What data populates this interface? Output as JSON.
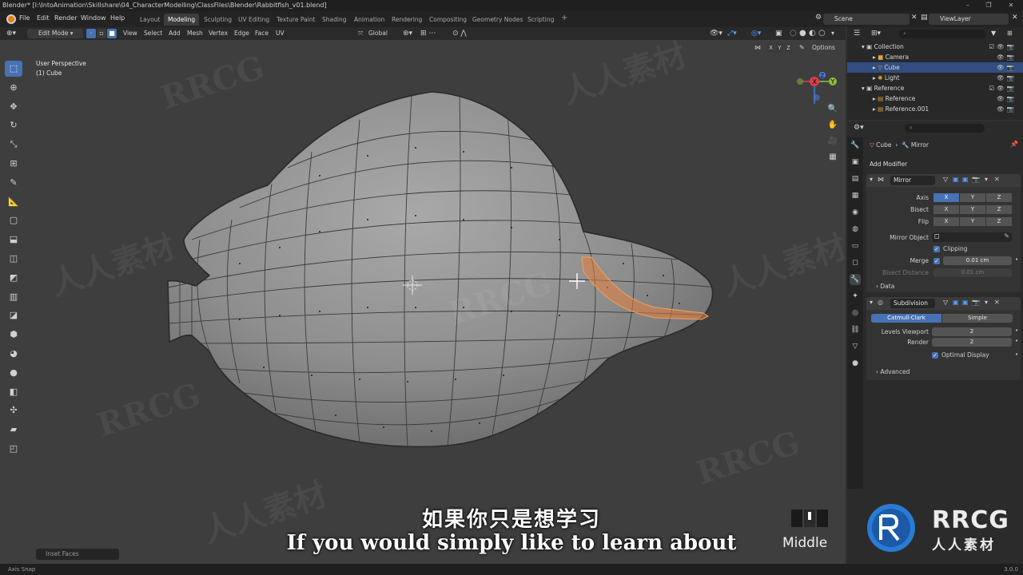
{
  "window": {
    "title": "Blender* [I:\\IntoAnimation\\Skillshare\\04_CharacterModelling\\ClassFiles\\Blender\\Rabbitfish_v01.blend]"
  },
  "menu": [
    "File",
    "Edit",
    "Render",
    "Window",
    "Help"
  ],
  "workspaces": [
    {
      "label": "Layout",
      "active": false
    },
    {
      "label": "Modeling",
      "active": true
    },
    {
      "label": "Sculpting",
      "active": false
    },
    {
      "label": "UV Editing",
      "active": false
    },
    {
      "label": "Texture Paint",
      "active": false
    },
    {
      "label": "Shading",
      "active": false
    },
    {
      "label": "Animation",
      "active": false
    },
    {
      "label": "Rendering",
      "active": false
    },
    {
      "label": "Compositing",
      "active": false
    },
    {
      "label": "Geometry Nodes",
      "active": false
    },
    {
      "label": "Scripting",
      "active": false
    }
  ],
  "scene": {
    "name": "Scene",
    "view_layer": "ViewLayer"
  },
  "viewport": {
    "mode": "Edit Mode",
    "menus": [
      "View",
      "Select",
      "Add",
      "Mesh",
      "Vertex",
      "Edge",
      "Face",
      "UV"
    ],
    "orientation": "Global",
    "perspective_label": "User Perspective",
    "object_label": "(1) Cube",
    "axes": [
      "X",
      "Y",
      "Z"
    ],
    "options_label": "Options",
    "gizmo_labels": {
      "x": "X",
      "y": "Y",
      "z": "Z"
    }
  },
  "outliner": {
    "rows": [
      {
        "label": "Collection",
        "indent": 1,
        "selected": false,
        "icon": "collection-icon"
      },
      {
        "label": "Camera",
        "indent": 2,
        "selected": false,
        "icon": "camera-icon"
      },
      {
        "label": "Cube",
        "indent": 2,
        "selected": true,
        "icon": "mesh-icon"
      },
      {
        "label": "Light",
        "indent": 2,
        "selected": false,
        "icon": "light-icon"
      },
      {
        "label": "Reference",
        "indent": 1,
        "selected": false,
        "icon": "collection-icon"
      },
      {
        "label": "Reference",
        "indent": 2,
        "selected": false,
        "icon": "image-icon"
      },
      {
        "label": "Reference.001",
        "indent": 2,
        "selected": false,
        "icon": "image-icon"
      }
    ]
  },
  "properties": {
    "breadcrumb_object": "Cube",
    "breadcrumb_modifier": "Mirror",
    "add_modifier_label": "Add Modifier",
    "mirror": {
      "name": "Mirror",
      "axis_label": "Axis",
      "bisect_label": "Bisect",
      "flip_label": "Flip",
      "axis": [
        true,
        false,
        false
      ],
      "bisect": [
        false,
        false,
        false
      ],
      "flip": [
        false,
        false,
        false
      ],
      "xyz": [
        "X",
        "Y",
        "Z"
      ],
      "mirror_object_label": "Mirror Object",
      "clipping_label": "Clipping",
      "merge_label": "Merge",
      "merge_value": "0.01 cm",
      "bisect_distance_label": "Bisect Distance",
      "bisect_distance_value": "0.01 cm",
      "data_label": "Data"
    },
    "subdivision": {
      "name": "Subdivision",
      "mode_catmull": "Catmull-Clark",
      "mode_simple": "Simple",
      "levels_viewport_label": "Levels Viewport",
      "levels_viewport_value": "2",
      "render_label": "Render",
      "render_value": "2",
      "optimal_display_label": "Optimal Display",
      "advanced_label": "Advanced"
    }
  },
  "operator_panel": "Inset Faces",
  "status": {
    "left": "Axis Snap",
    "version": "3.0.0"
  },
  "overlay": {
    "subtitle_cn": "如果你只是想学习",
    "subtitle_en": "If you would simply like to learn about",
    "mouse_label": "Middle"
  },
  "branding": {
    "watermark": "RRCG",
    "watermark_cn": "人人素材",
    "logo_text": "RRCG",
    "logo_cn": "人人素材"
  },
  "colors": {
    "accent": "#4772b3",
    "selection_edge": "#e8823c",
    "logo_blue": "#2a7bd5"
  }
}
